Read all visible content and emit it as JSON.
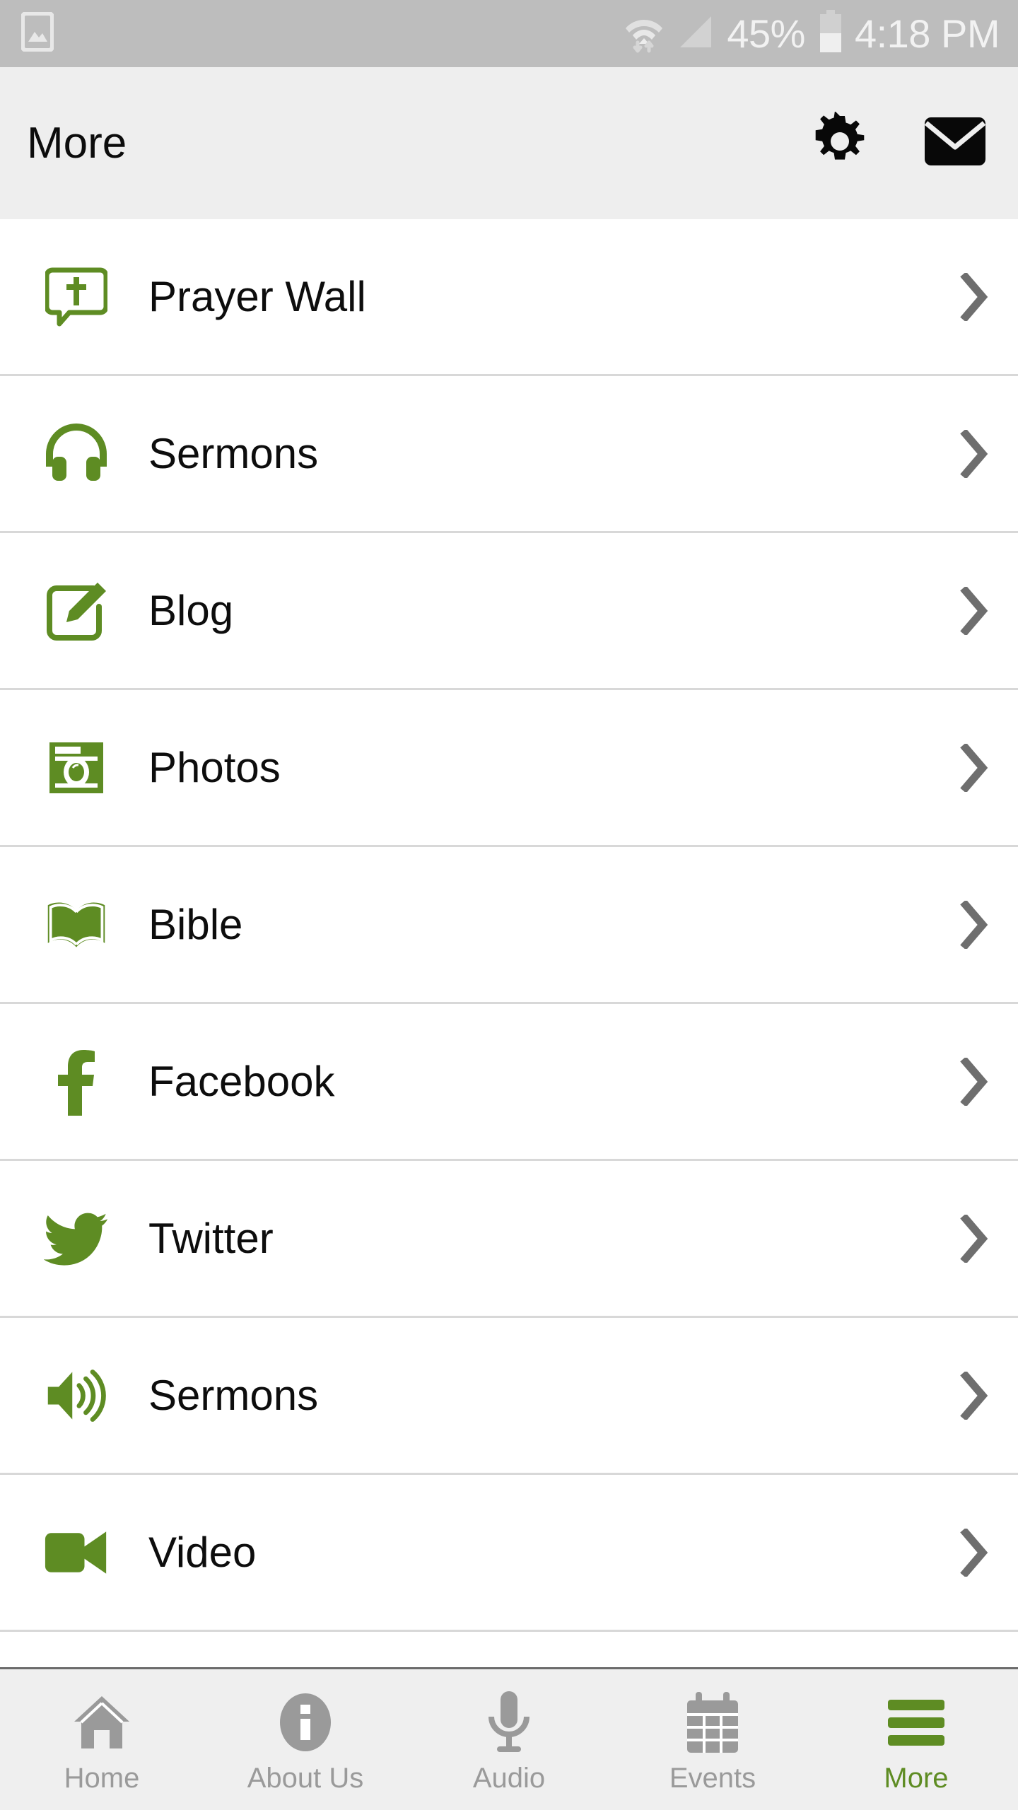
{
  "status_bar": {
    "left_icon": "image-gallery-icon",
    "wifi_icon": "wifi-with-data-transfer-icon",
    "signal_icon": "cellular-signal-icon",
    "battery_percent": "45%",
    "battery_icon": "battery-icon",
    "time": "4:18 PM",
    "background_color": "#bdbdbd",
    "text_color": "#f2f2f2"
  },
  "header": {
    "title": "More",
    "background_color": "#eeeeee",
    "settings_icon": "gear-icon",
    "mail_icon": "envelope-icon",
    "icon_color": "#000000"
  },
  "theme": {
    "accent_green": "#5e8c23",
    "row_text": "#0d0d0d",
    "chevron_gray": "#6e6e6e",
    "divider": "#d8d8d8",
    "nav_inactive": "#9a9a9a"
  },
  "menu": {
    "items": [
      {
        "label": "Prayer Wall",
        "icon": "prayer-speech-bubble-cross-icon",
        "chevron": "chevron-right-icon"
      },
      {
        "label": "Sermons",
        "icon": "headphones-icon",
        "chevron": "chevron-right-icon"
      },
      {
        "label": "Blog",
        "icon": "pencil-edit-square-icon",
        "chevron": "chevron-right-icon"
      },
      {
        "label": "Photos",
        "icon": "camera-icon",
        "chevron": "chevron-right-icon"
      },
      {
        "label": "Bible",
        "icon": "open-book-icon",
        "chevron": "chevron-right-icon"
      },
      {
        "label": "Facebook",
        "icon": "facebook-f-icon",
        "chevron": "chevron-right-icon"
      },
      {
        "label": "Twitter",
        "icon": "twitter-bird-icon",
        "chevron": "chevron-right-icon"
      },
      {
        "label": "Sermons",
        "icon": "speaker-volume-icon",
        "chevron": "chevron-right-icon"
      },
      {
        "label": "Video",
        "icon": "video-camera-icon",
        "chevron": "chevron-right-icon"
      }
    ]
  },
  "bottom_nav": {
    "items": [
      {
        "label": "Home",
        "icon": "home-icon",
        "active": false
      },
      {
        "label": "About Us",
        "icon": "info-icon",
        "active": false
      },
      {
        "label": "Audio",
        "icon": "microphone-icon",
        "active": false
      },
      {
        "label": "Events",
        "icon": "calendar-icon",
        "active": false
      },
      {
        "label": "More",
        "icon": "hamburger-menu-icon",
        "active": true
      }
    ]
  }
}
